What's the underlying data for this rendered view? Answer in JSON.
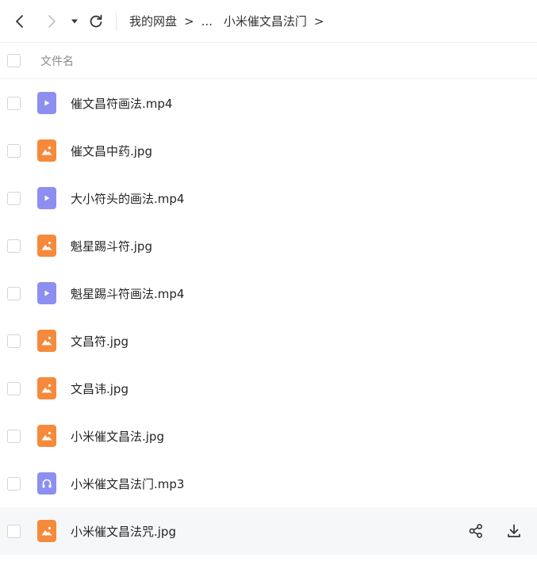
{
  "breadcrumb": {
    "root": "我的网盘",
    "separator": ">",
    "ellipsis": "...",
    "current": "小米催文昌法门"
  },
  "header": {
    "name_column": "文件名"
  },
  "colors": {
    "video": "#8c8ff0",
    "image": "#f58a3c",
    "audio": "#8c8ff0"
  },
  "files": [
    {
      "name": "催文昌符画法.mp4",
      "type": "video",
      "icon": "play-icon"
    },
    {
      "name": "催文昌中药.jpg",
      "type": "image",
      "icon": "image-icon"
    },
    {
      "name": "大小符头的画法.mp4",
      "type": "video",
      "icon": "play-icon"
    },
    {
      "name": "魁星踢斗符.jpg",
      "type": "image",
      "icon": "image-icon"
    },
    {
      "name": "魁星踢斗符画法.mp4",
      "type": "video",
      "icon": "play-icon"
    },
    {
      "name": "文昌符.jpg",
      "type": "image",
      "icon": "image-icon"
    },
    {
      "name": "文昌讳.jpg",
      "type": "image",
      "icon": "image-icon"
    },
    {
      "name": "小米催文昌法.jpg",
      "type": "image",
      "icon": "image-icon"
    },
    {
      "name": "小米催文昌法门.mp3",
      "type": "audio",
      "icon": "headphones-icon"
    },
    {
      "name": "小米催文昌法咒.jpg",
      "type": "image",
      "icon": "image-icon",
      "hovered": true
    }
  ]
}
